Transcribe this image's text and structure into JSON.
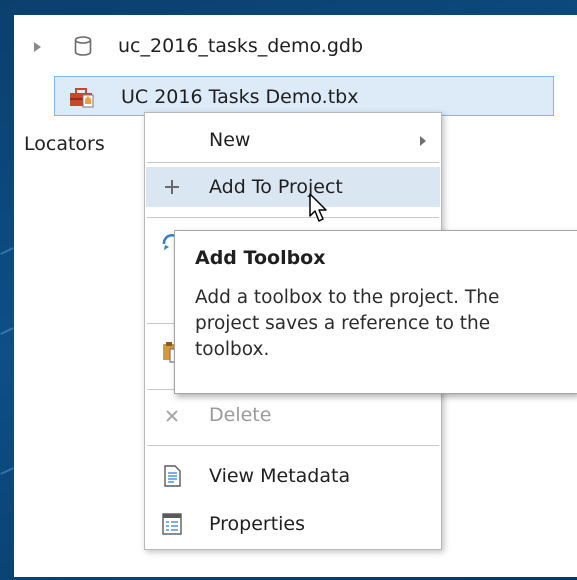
{
  "tree": {
    "gdb_item": {
      "label": "uc_2016_tasks_demo.gdb",
      "icon": "database-icon"
    },
    "tbx_item": {
      "label": "UC 2016 Tasks Demo.tbx",
      "icon": "toolbox-icon"
    },
    "locators_label": "Locators"
  },
  "context_menu": {
    "items": [
      {
        "label": "New",
        "icon": "",
        "has_submenu": true
      },
      {
        "label": "Add To Project",
        "icon": "plus-icon"
      },
      {
        "label": "Delete",
        "icon": "delete-x-icon",
        "disabled": true
      },
      {
        "label": "View Metadata",
        "icon": "metadata-document-icon"
      },
      {
        "label": "Properties",
        "icon": "properties-icon"
      }
    ]
  },
  "tooltip": {
    "title": "Add Toolbox",
    "body": "Add a toolbox to the project. The project saves a reference to the toolbox."
  },
  "colors": {
    "selection_fill": "#dcebf7",
    "selection_border": "#7fb7e6",
    "menu_hover": "#dae7f3",
    "toolbox_red": "#c8472a"
  }
}
